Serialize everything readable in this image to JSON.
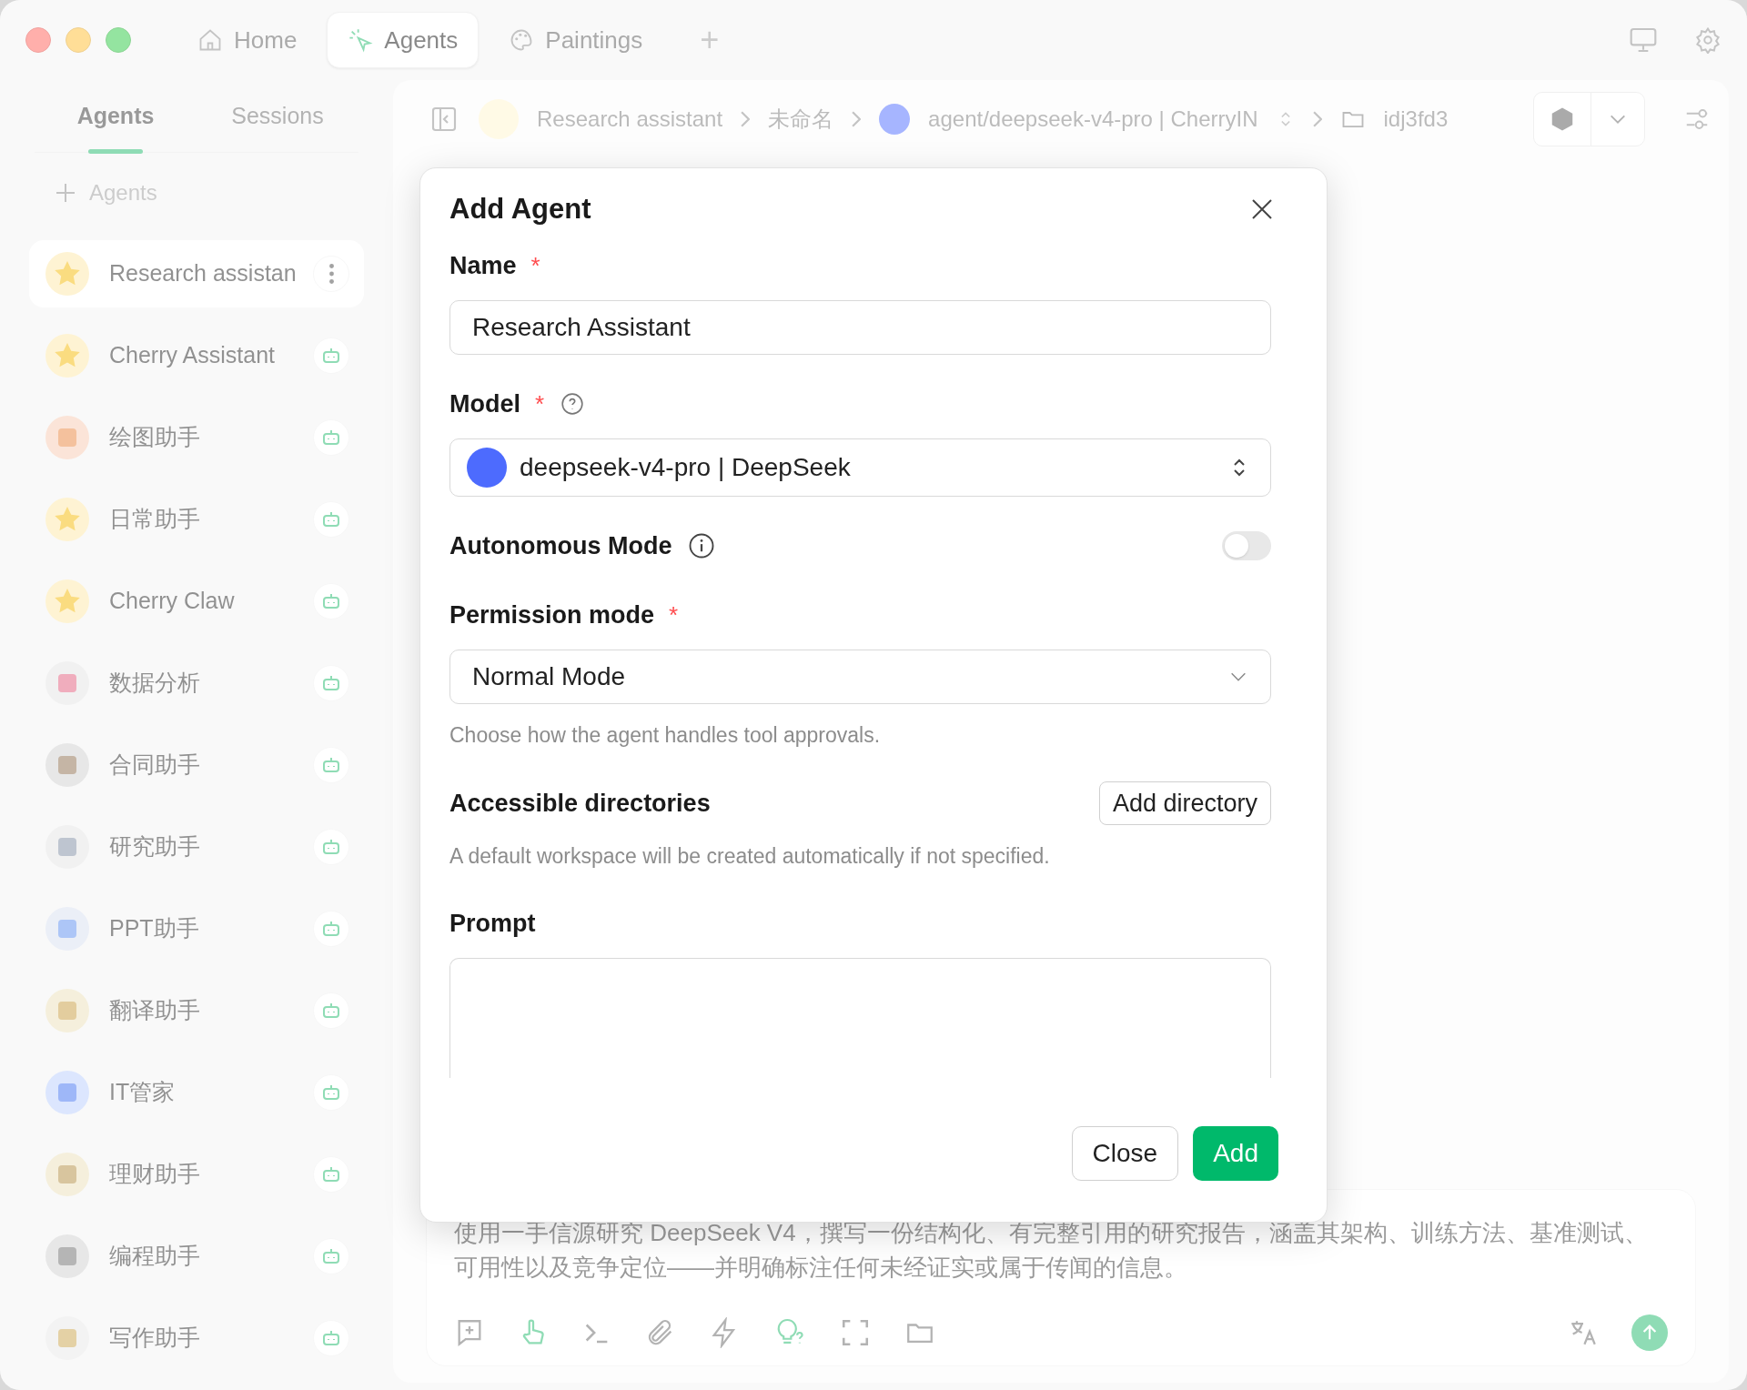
{
  "top_tabs": [
    {
      "label": "Home",
      "selected": false
    },
    {
      "label": "Agents",
      "selected": true
    },
    {
      "label": "Paintings",
      "selected": false
    }
  ],
  "new_tab": "+",
  "sidebar": {
    "tabs": [
      {
        "label": "Agents",
        "selected": true
      },
      {
        "label": "Sessions",
        "selected": false
      }
    ],
    "add_label": "Agents",
    "items": [
      {
        "label": "Research assistan",
        "selected": true
      },
      {
        "label": "Cherry Assistant",
        "selected": false
      },
      {
        "label": "绘图助手",
        "selected": false
      },
      {
        "label": "日常助手",
        "selected": false
      },
      {
        "label": "Cherry Claw",
        "selected": false
      },
      {
        "label": "数据分析",
        "selected": false
      },
      {
        "label": "合同助手",
        "selected": false
      },
      {
        "label": "研究助手",
        "selected": false
      },
      {
        "label": "PPT助手",
        "selected": false
      },
      {
        "label": "翻译助手",
        "selected": false
      },
      {
        "label": "IT管家",
        "selected": false
      },
      {
        "label": "理财助手",
        "selected": false
      },
      {
        "label": "编程助手",
        "selected": false
      },
      {
        "label": "写作助手",
        "selected": false
      }
    ]
  },
  "breadcrumb": [
    "Research assistant",
    "未命名",
    "agent/deepseek-v4-pro | CherryIN",
    "idj3fd3"
  ],
  "composer": {
    "value": "使用一手信源研究 DeepSeek V4，撰写一份结构化、有完整引用的研究报告，涵盖其架构、训练方法、基准测试、可用性以及竞争定位——并明确标注任何未经证实或属于传闻的信息。"
  },
  "dialog": {
    "title": "Add Agent",
    "name": {
      "label": "Name",
      "marker": "*",
      "value": "Research Assistant"
    },
    "model": {
      "label": "Model",
      "marker": "*",
      "value": "deepseek-v4-pro | DeepSeek"
    },
    "autonomous": {
      "label": "Autonomous Mode",
      "on": false
    },
    "permission": {
      "label": "Permission mode",
      "marker": "*",
      "value": "Normal Mode",
      "hint": "Choose how the agent handles tool approvals."
    },
    "directories": {
      "label": "Accessible directories",
      "button": "Add directory",
      "hint": "A default workspace will be created automatically if not specified."
    },
    "prompt": {
      "label": "Prompt"
    },
    "buttons": [
      "Close",
      "Add"
    ]
  }
}
